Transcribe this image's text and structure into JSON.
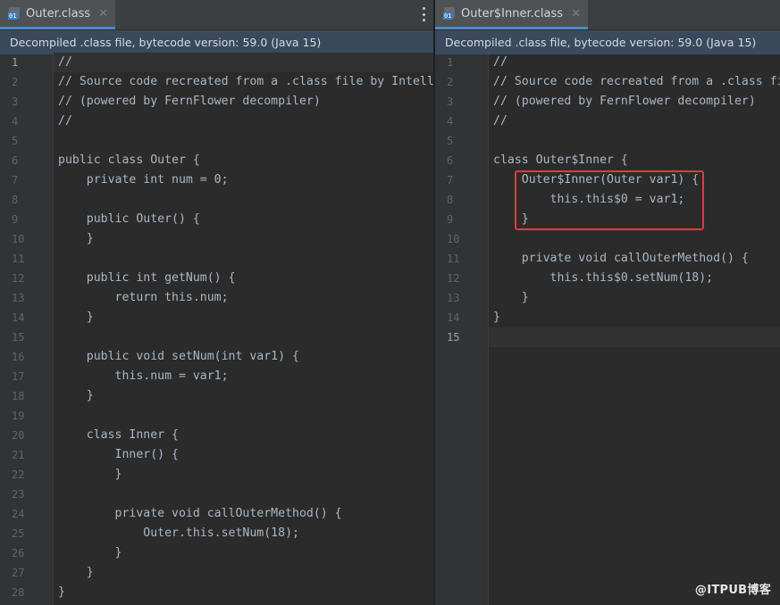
{
  "left_pane": {
    "tab": {
      "title": "Outer.class",
      "icon": "class-file-icon",
      "close": "✕"
    },
    "banner": "Decompiled .class file, bytecode version: 59.0 (Java 15)",
    "active_line": 1,
    "lines": [
      "//",
      "// Source code recreated from a .class file by IntelliJ IDEA",
      "// (powered by FernFlower decompiler)",
      "//",
      "",
      "public class Outer {",
      "    private int num = 0;",
      "",
      "    public Outer() {",
      "    }",
      "",
      "    public int getNum() {",
      "        return this.num;",
      "    }",
      "",
      "    public void setNum(int var1) {",
      "        this.num = var1;",
      "    }",
      "",
      "    class Inner {",
      "        Inner() {",
      "        }",
      "",
      "        private void callOuterMethod() {",
      "            Outer.this.setNum(18);",
      "        }",
      "    }",
      "}"
    ]
  },
  "right_pane": {
    "tab": {
      "title": "Outer$Inner.class",
      "icon": "class-file-icon",
      "close": "✕"
    },
    "banner": "Decompiled .class file, bytecode version: 59.0 (Java 15)",
    "active_line": 15,
    "lines": [
      "//",
      "// Source code recreated from a .class file by IntelliJ IDEA",
      "// (powered by FernFlower decompiler)",
      "//",
      "",
      "class Outer$Inner {",
      "    Outer$Inner(Outer var1) {",
      "        this.this$0 = var1;",
      "    }",
      "",
      "    private void callOuterMethod() {",
      "        this.this$0.setNum(18);",
      "    }",
      "}",
      ""
    ]
  },
  "watermark": "@ITPUB博客",
  "colors": {
    "accent": "#4a88c7",
    "highlight_box": "#e23b3b",
    "banner_bg": "#3a4a5c"
  }
}
